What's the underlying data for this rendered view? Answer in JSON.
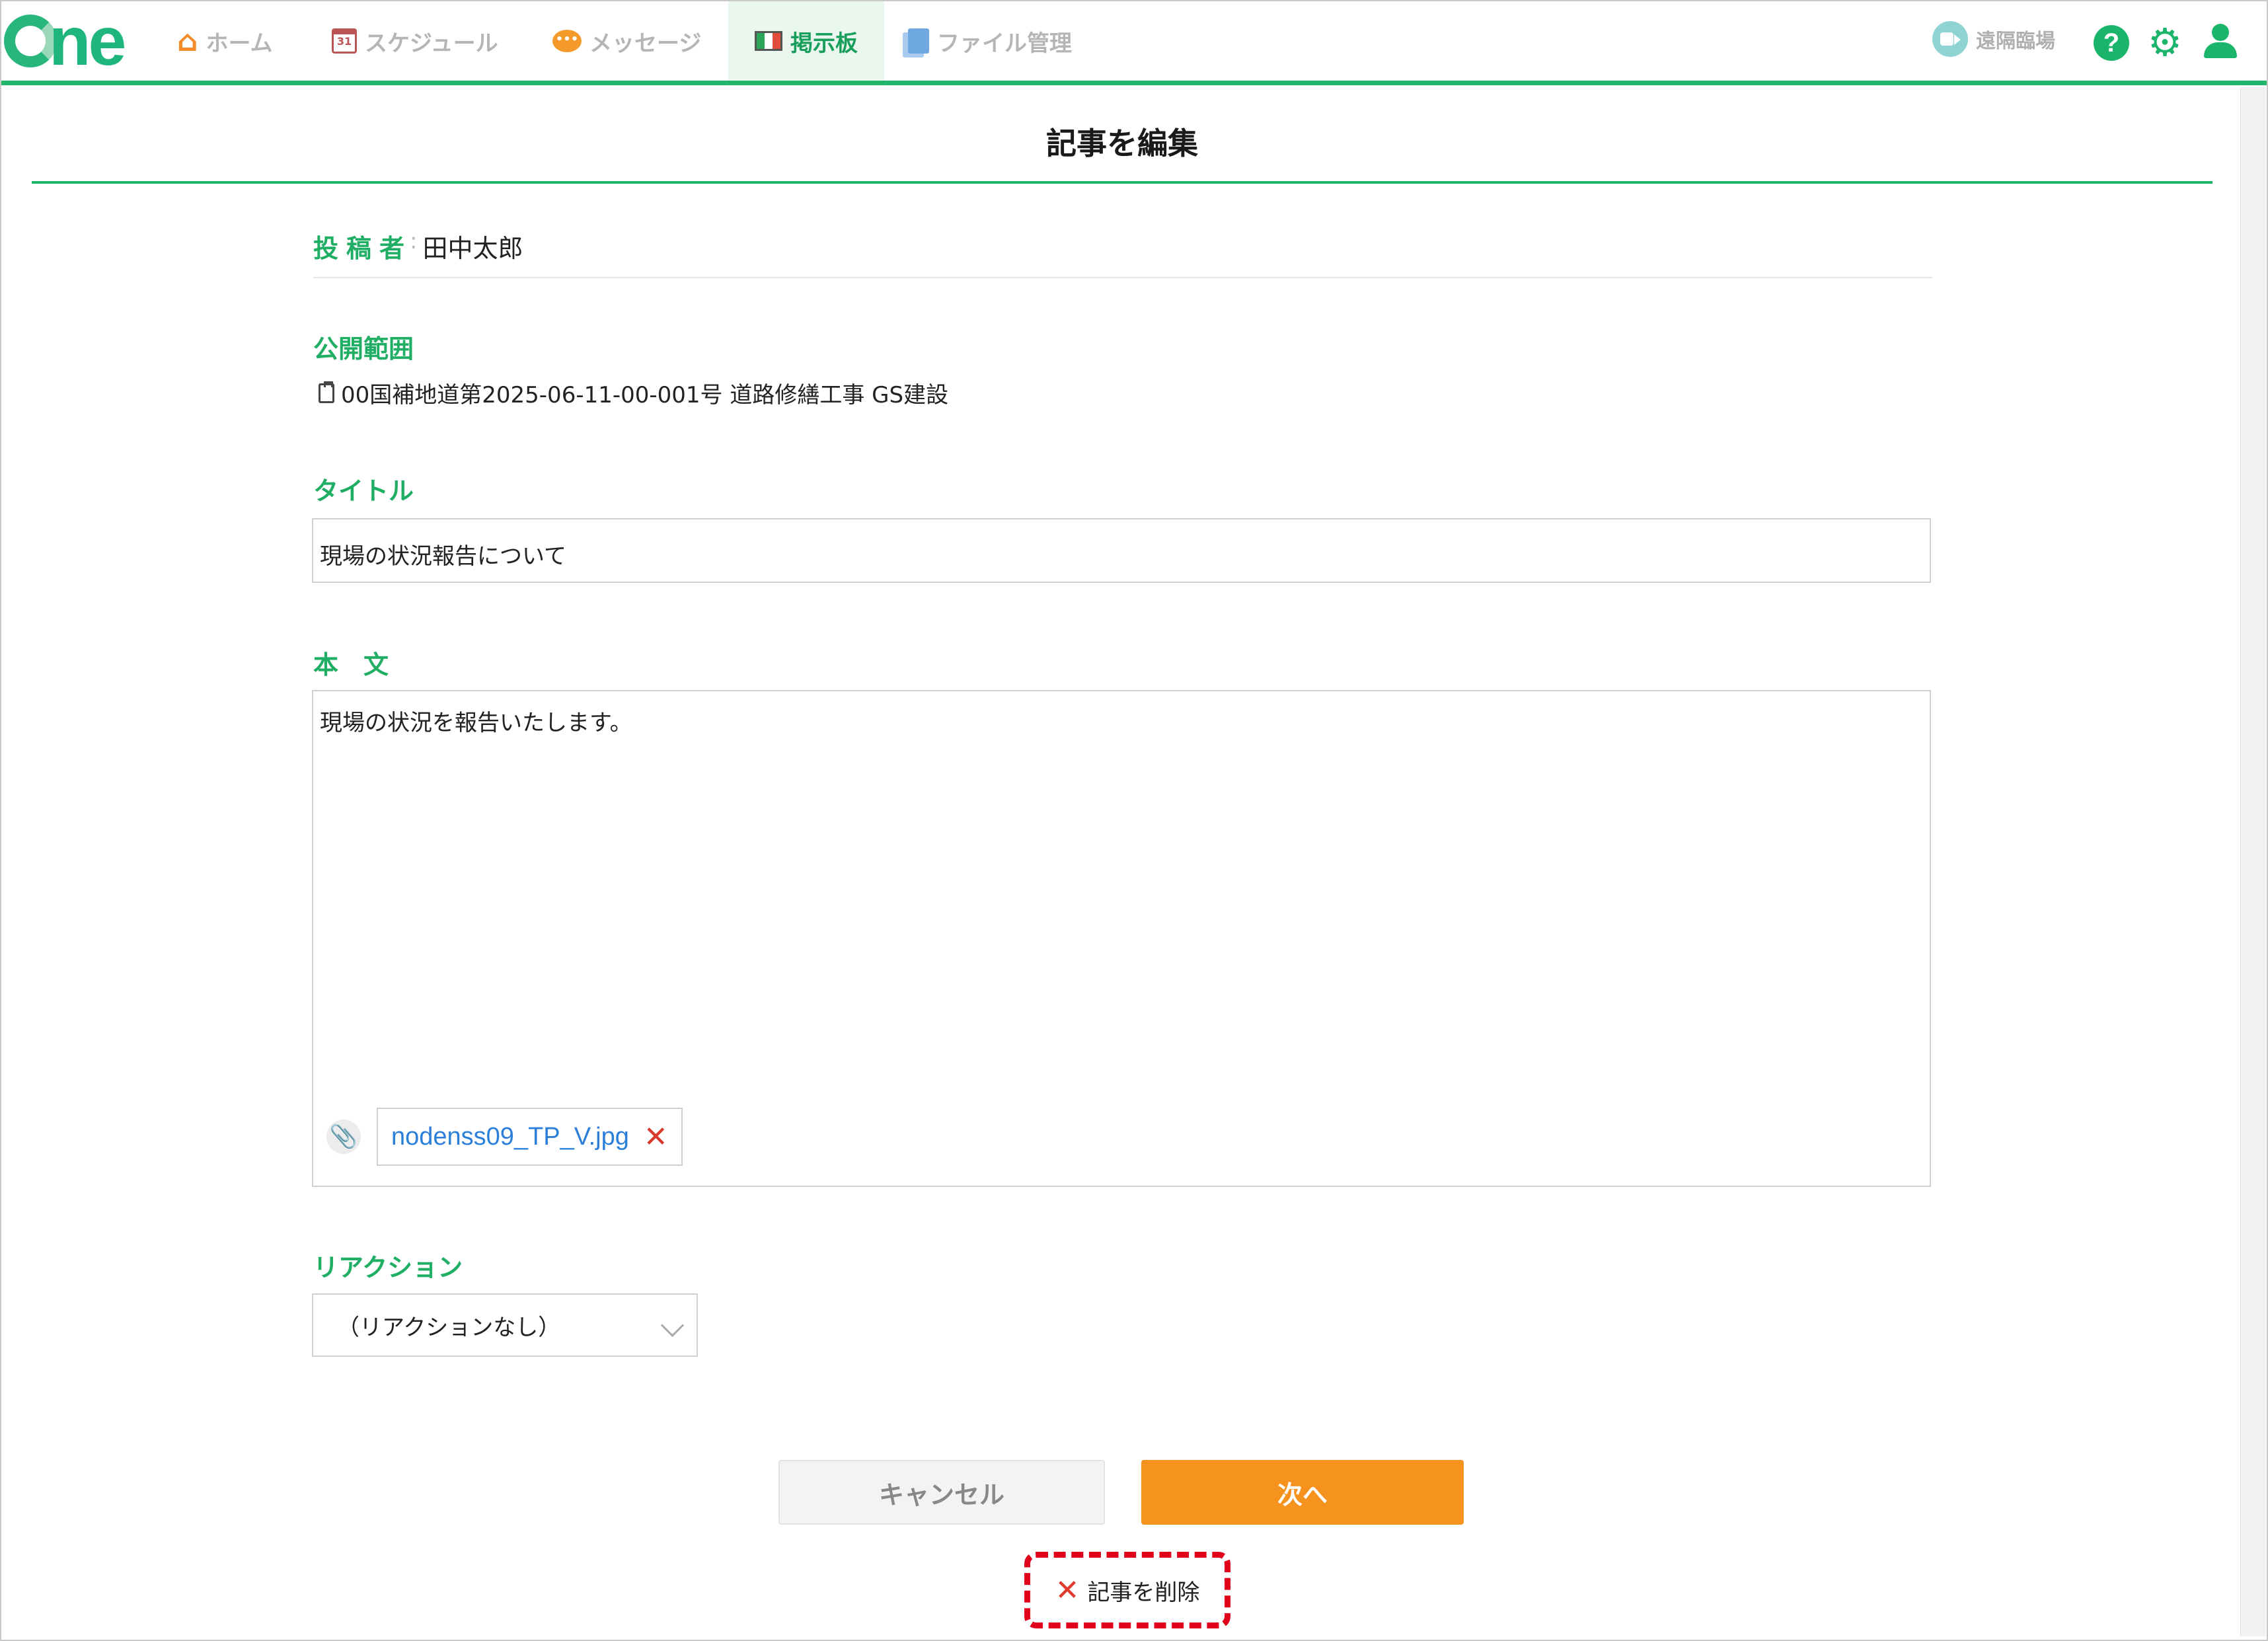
{
  "nav": {
    "logo": "One",
    "items": [
      {
        "label": "ホーム",
        "icon": "home-icon"
      },
      {
        "label": "スケジュール",
        "icon": "calendar-icon"
      },
      {
        "label": "メッセージ",
        "icon": "message-icon"
      },
      {
        "label": "掲示板",
        "icon": "board-icon",
        "active": true
      },
      {
        "label": "ファイル管理",
        "icon": "file-icon"
      }
    ],
    "remote_label": "遠隔臨場",
    "help_glyph": "?",
    "accent_color": "#1eb46a"
  },
  "page": {
    "title": "記事を編集"
  },
  "form": {
    "author_label": "投稿者",
    "author_name": "田中太郎",
    "scope_label": "公開範囲",
    "scope_value": "00国補地道第2025-06-11-00-001号 道路修繕工事 GS建設",
    "title_label": "タイトル",
    "title_value": "現場の状況報告について",
    "body_label": "本　文",
    "body_value": "現場の状況を報告いたします。",
    "attachment_name": "nodenss09_TP_V.jpg",
    "reaction_label": "リアクション",
    "reaction_selected": "（リアクションなし）"
  },
  "actions": {
    "cancel": "キャンセル",
    "next": "次へ",
    "delete": "記事を削除"
  }
}
